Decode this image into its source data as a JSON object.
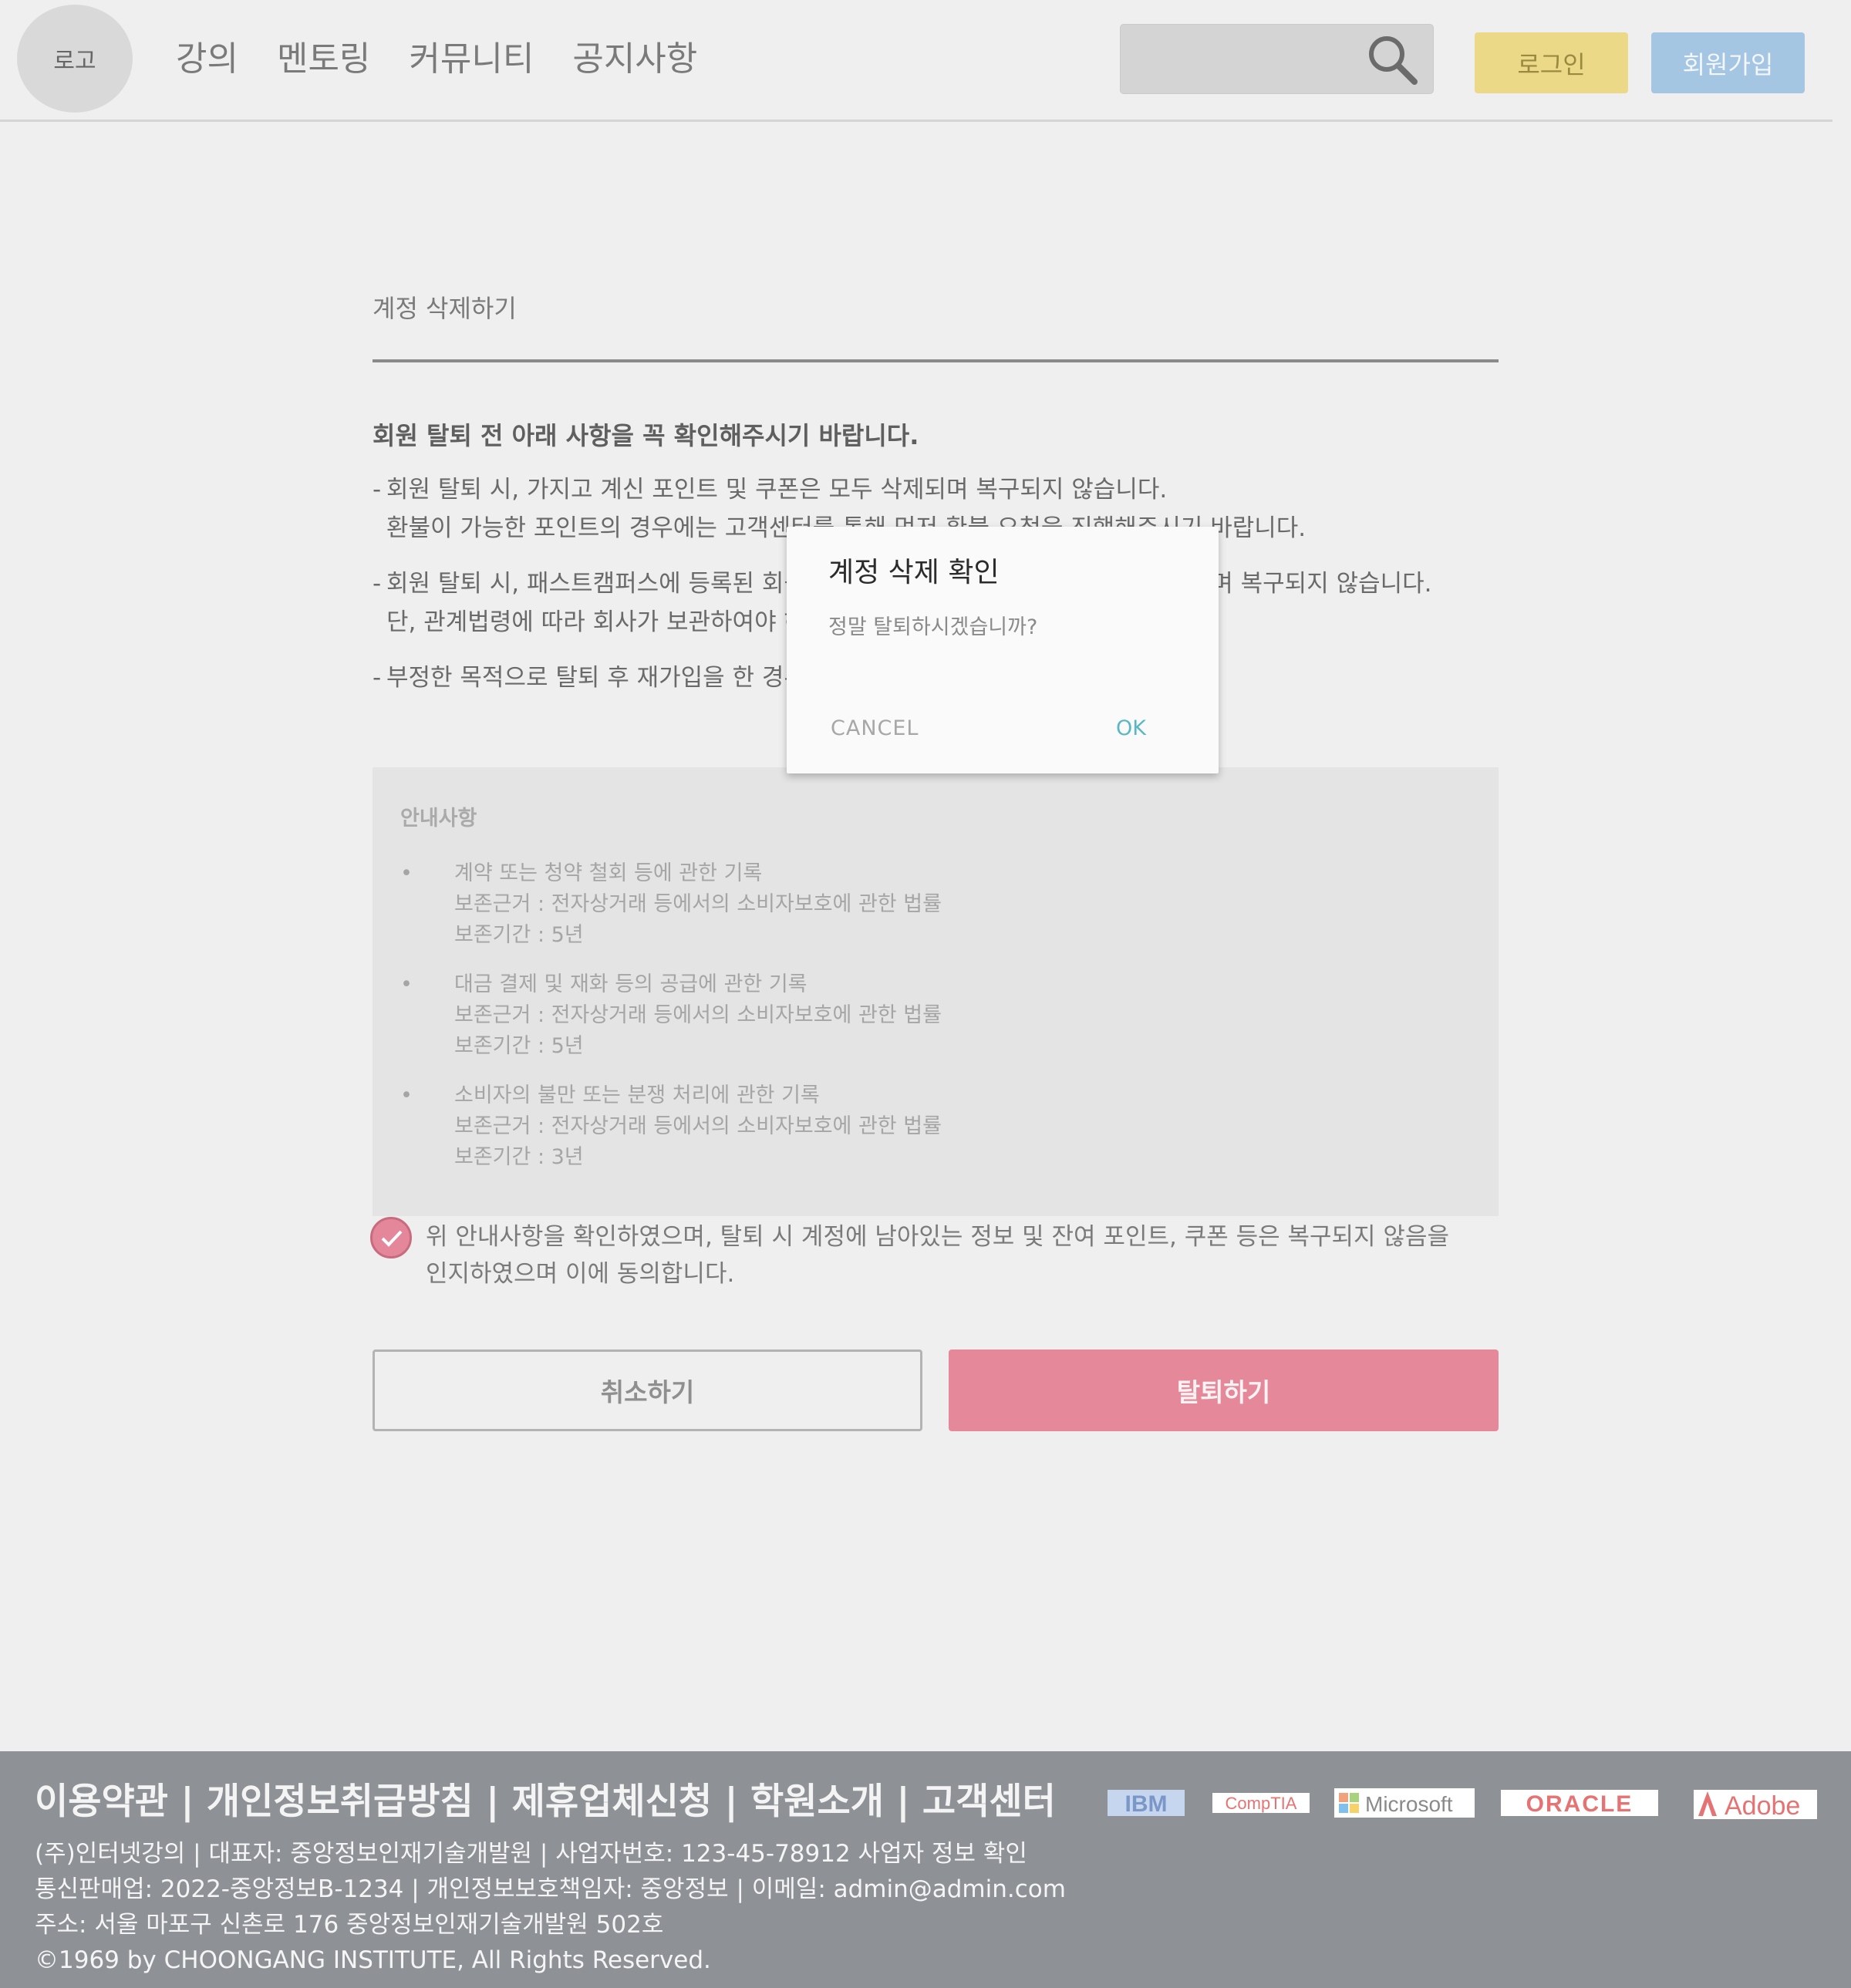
{
  "header": {
    "logo": "로고",
    "nav": [
      "강의",
      "멘토링",
      "커뮤니티",
      "공지사항"
    ],
    "search_placeholder": "",
    "login": "로그인",
    "signup": "회원가입"
  },
  "page": {
    "title": "계정 삭제하기",
    "notice_heading": "회원 탈퇴 전 아래 사항을 꼭 확인해주시기 바랍니다.",
    "notices": [
      {
        "line1": "회원 탈퇴 시, 가지고 계신 포인트 및 쿠폰은 모두 삭제되며 복구되지 않습니다.",
        "line2": "환불이 가능한 포인트의 경우에는 고객센터를 통해 먼저 환불 요청을 진행해주시기 바랍니다."
      },
      {
        "line1": "회원 탈퇴 시, 패스트캠퍼스에 등록된 회원정보 및 수강 이력 등 모든 정보는 삭제되며 복구되지 않습니다.",
        "line2": "단, 관계법령에 따라 회사가 보관하여야 하는 정보는 일정 기간 보관됩니다."
      },
      {
        "line1": "부정한 목적으로 탈퇴 후 재가입을 한 경우 서비스 이용이 제한될 수 있습니다.",
        "line2": ""
      }
    ],
    "info_title": "안내사항",
    "info_items": [
      {
        "title": "계약 또는 청약 철회 등에 관한 기록",
        "basis": "보존근거 : 전자상거래 등에서의 소비자보호에 관한 법률",
        "period": "보존기간 : 5년"
      },
      {
        "title": "대금 결제 및 재화 등의 공급에 관한 기록",
        "basis": "보존근거 : 전자상거래 등에서의 소비자보호에 관한 법률",
        "period": "보존기간 : 5년"
      },
      {
        "title": "소비자의 불만 또는 분쟁 처리에 관한 기록",
        "basis": "보존근거 : 전자상거래 등에서의 소비자보호에 관한 법률",
        "period": "보존기간 : 3년"
      }
    ],
    "agree_line1": "위 안내사항을 확인하였으며, 탈퇴 시 계정에 남아있는 정보 및 잔여 포인트, 쿠폰 등은 복구되지 않음을",
    "agree_line2": "인지하였으며 이에 동의합니다.",
    "agree_checked": true,
    "cancel_button": "취소하기",
    "withdraw_button": "탈퇴하기"
  },
  "dialog": {
    "title": "계정 삭제 확인",
    "message": "정말 탈퇴하시겠습니까?",
    "cancel": "CANCEL",
    "ok": "OK"
  },
  "footer": {
    "links_text": "이용약관 | 개인정보취급방침 | 제휴업체신청 | 학원소개 | 고객센터",
    "partner_logos": [
      "IBM",
      "CompTIA",
      "Microsoft",
      "ORACLE",
      "Adobe"
    ],
    "line1": "(주)인터넷강의 | 대표자: 중앙정보인재기술개발원 | 사업자번호: 123-45-78912 사업자 정보 확인",
    "line2": "통신판매업: 2022-중앙정보B-1234 | 개인정보보호책임자: 중앙정보 | 이메일: admin@admin.com",
    "line3": "주소: 서울 마포구 신촌로 176 중앙정보인재기술개발원 502호",
    "line4": "©1969 by CHOONGANG INSTITUTE, All Rights Reserved."
  },
  "colors": {
    "login_bg": "#ecd987",
    "signup_bg": "#a4c6e2",
    "withdraw_bg": "#e58899",
    "ok_text": "#5ab7c3",
    "footer_bg": "#8e9196"
  }
}
